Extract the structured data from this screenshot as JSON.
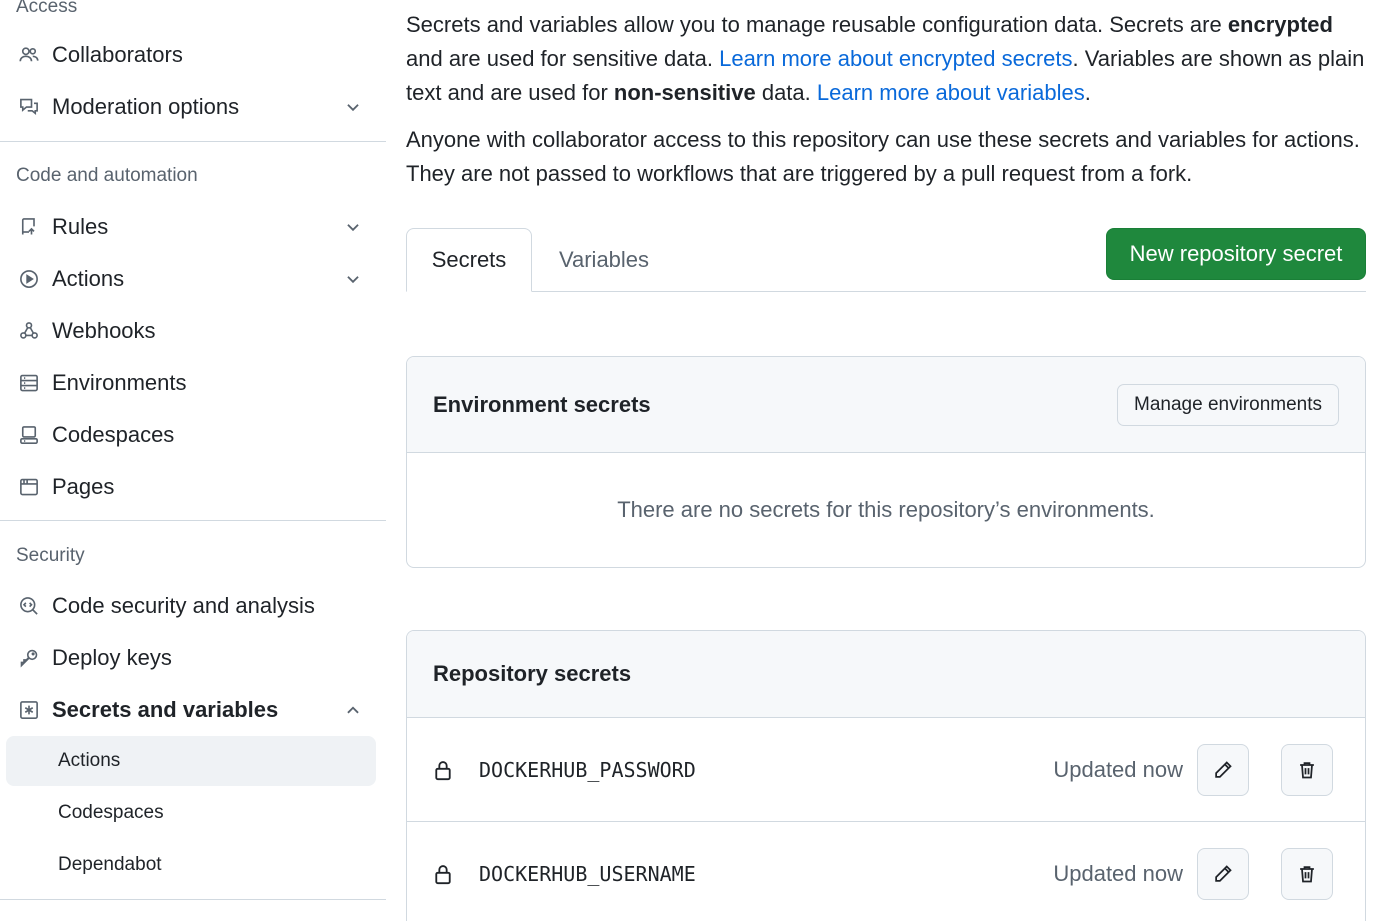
{
  "sidebar": {
    "access_heading": "Access",
    "access_items": [
      {
        "label": "Collaborators",
        "icon": "people-icon"
      },
      {
        "label": "Moderation options",
        "icon": "comment-discussion-icon"
      }
    ],
    "code_heading": "Code and automation",
    "code_items": [
      {
        "label": "Rules",
        "icon": "repo-push-icon"
      },
      {
        "label": "Actions",
        "icon": "play-icon"
      },
      {
        "label": "Webhooks",
        "icon": "webhook-icon"
      },
      {
        "label": "Environments",
        "icon": "server-icon"
      },
      {
        "label": "Codespaces",
        "icon": "codespaces-icon"
      },
      {
        "label": "Pages",
        "icon": "browser-icon"
      }
    ],
    "security_heading": "Security",
    "security_items": [
      {
        "label": "Code security and analysis",
        "icon": "codescan-icon"
      },
      {
        "label": "Deploy keys",
        "icon": "key-icon"
      },
      {
        "label": "Secrets and variables",
        "icon": "key-asterisk-icon"
      }
    ],
    "secrets_sub_items": [
      {
        "label": "Actions",
        "active": true
      },
      {
        "label": "Codespaces",
        "active": false
      },
      {
        "label": "Dependabot",
        "active": false
      }
    ]
  },
  "intro": {
    "p1_a": "Secrets and variables allow you to manage reusable configuration data. Secrets are ",
    "p1_b": "encrypted",
    "p1_c": " and are used for sensitive data. ",
    "p1_link1": "Learn more about encrypted secrets",
    "p1_d": ". Variables are shown as plain text and are used for ",
    "p1_e": "non-sensitive",
    "p1_f": " data. ",
    "p1_link2": "Learn more about variables",
    "p1_g": ".",
    "p2": "Anyone with collaborator access to this repository can use these secrets and variables for actions. They are not passed to workflows that are triggered by a pull request from a fork."
  },
  "tabs": {
    "secrets": "Secrets",
    "variables": "Variables"
  },
  "new_secret_button": "New repository secret",
  "environment_secrets": {
    "title": "Environment secrets",
    "manage_button": "Manage environments",
    "empty_message": "There are no secrets for this repository’s environments."
  },
  "repository_secrets": {
    "title": "Repository secrets",
    "rows": [
      {
        "name": "DOCKERHUB_PASSWORD",
        "updated": "Updated now"
      },
      {
        "name": "DOCKERHUB_USERNAME",
        "updated": "Updated now"
      }
    ]
  },
  "colors": {
    "primary_green": "#1f883d",
    "link_blue": "#0969da",
    "muted_text": "#59636e",
    "border": "#d1d9e0"
  }
}
